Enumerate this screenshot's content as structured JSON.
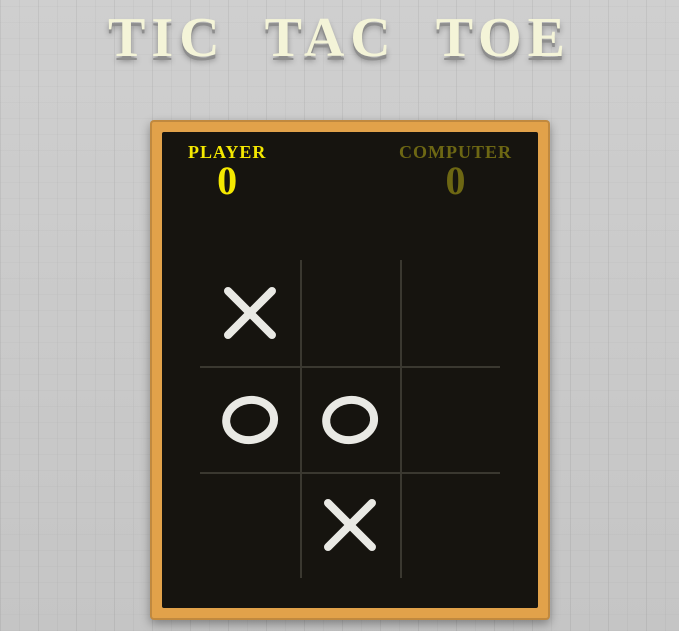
{
  "title": "TIC  TAC  TOE",
  "scores": {
    "player_label": "PLAYER",
    "player_score": "0",
    "computer_label": "COMPUTER",
    "computer_score": "0"
  },
  "board": {
    "rows": 3,
    "cols": 3,
    "cells": [
      [
        "X",
        "",
        ""
      ],
      [
        "O",
        "O",
        ""
      ],
      [
        "",
        "X",
        ""
      ]
    ]
  },
  "colors": {
    "frame": "#e2a24a",
    "chalkboard": "#16140f",
    "grid_line": "#3a3830",
    "mark": "#e9e9e4",
    "player_active": "#f4e800",
    "computer_dim": "#6d6713"
  }
}
